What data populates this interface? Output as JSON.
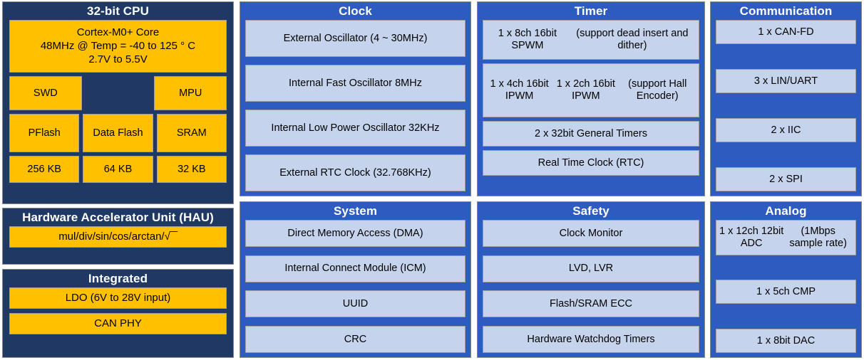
{
  "colors": {
    "navy": "#1f3864",
    "blue": "#2e5bc0",
    "amber": "#ffc000",
    "light_blue": "#c5d4ec",
    "background": "#ffffff",
    "title_text": "#ffffff",
    "item_text": "#000000"
  },
  "panels": {
    "cpu": {
      "title": "32-bit CPU",
      "core": "Cortex-M0+ Core\n48MHz @ Temp = -40 to 125 ° C\n2.7V to 5.5V",
      "core_line1": "Cortex-M0+ Core",
      "core_line2": "48MHz @ Temp = -40 to 125 ° C",
      "core_line3": "2.7V to 5.5V",
      "swd": "SWD",
      "mpu": "MPU",
      "pflash": "PFlash",
      "data_flash": "Data Flash",
      "sram": "SRAM",
      "pflash_size": "256 KB",
      "data_flash_size": "64 KB",
      "sram_size": "32 KB"
    },
    "hau": {
      "title": "Hardware Accelerator Unit (HAU)",
      "items": [
        "mul/div/sin/cos/arctan/√‾‾"
      ]
    },
    "integrated": {
      "title": "Integrated",
      "items": [
        "LDO (6V to 28V input)",
        "CAN PHY"
      ]
    },
    "clock": {
      "title": "Clock",
      "items": [
        "External Oscillator (4 ~ 30MHz)",
        "Internal Fast Oscillator 8MHz",
        "Internal Low Power Oscillator 32KHz",
        "External RTC Clock (32.768KHz)"
      ]
    },
    "timer": {
      "title": "Timer",
      "items": [
        "1 x 8ch 16bit SPWM\n(support dead insert and dither)",
        "1 x 4ch 16bit IPWM\n1 x 2ch 16bit IPWM\n(support Hall Encoder)",
        "2 x 32bit General Timers",
        "Real Time Clock (RTC)"
      ]
    },
    "communication": {
      "title": "Communication",
      "items": [
        "1 x CAN-FD",
        "3 x LIN/UART",
        "2 x IIC",
        "2 x SPI"
      ]
    },
    "system": {
      "title": "System",
      "items": [
        "Direct Memory Access (DMA)",
        "Internal Connect Module (ICM)",
        "UUID",
        "CRC"
      ]
    },
    "safety": {
      "title": "Safety",
      "items": [
        "Clock Monitor",
        "LVD, LVR",
        "Flash/SRAM ECC",
        "Hardware Watchdog Timers"
      ]
    },
    "analog": {
      "title": "Analog",
      "items": [
        "1 x 12ch 12bit ADC\n(1Mbps sample rate)",
        "1 x 5ch CMP",
        "1 x 8bit DAC"
      ]
    }
  }
}
